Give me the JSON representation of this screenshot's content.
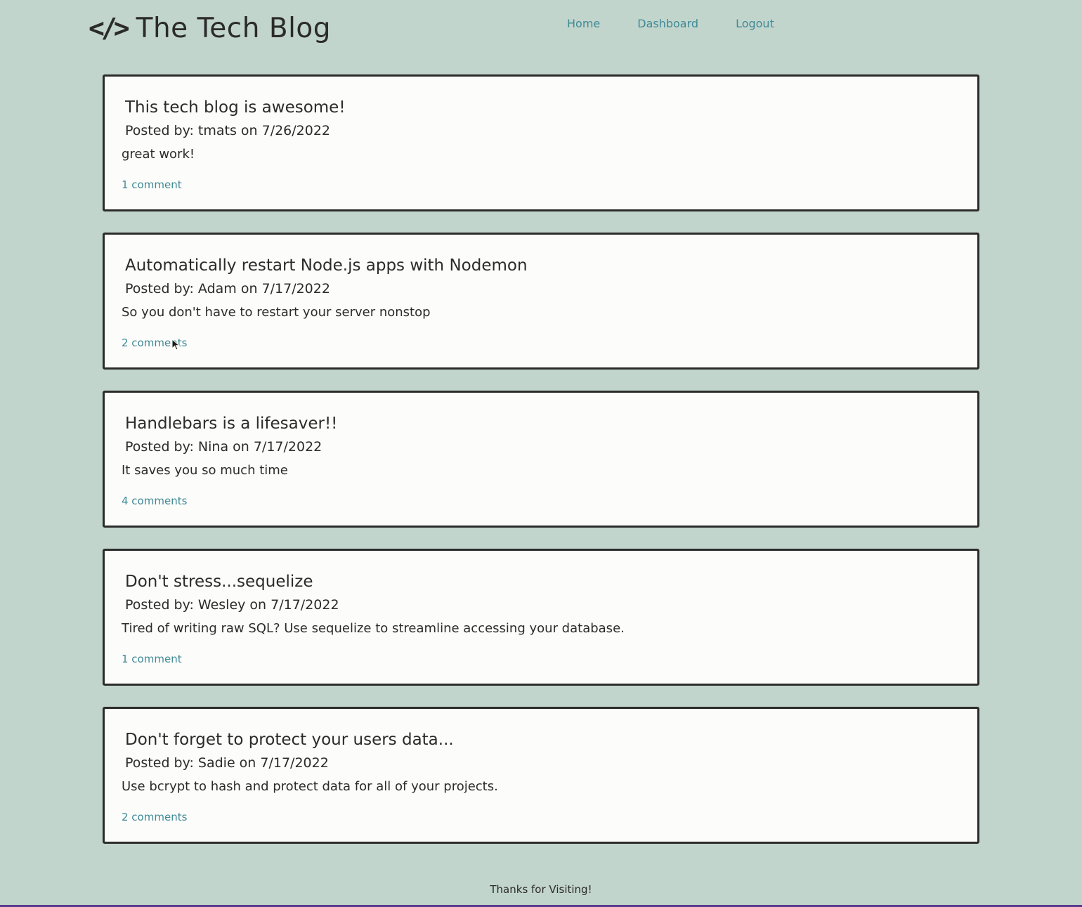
{
  "header": {
    "logo_icon": "</>",
    "title": "The Tech Blog",
    "nav": [
      "Home",
      "Dashboard",
      "Logout"
    ]
  },
  "posts": [
    {
      "title": "This tech blog is awesome!",
      "meta": "Posted by: tmats on 7/26/2022",
      "body": "great work!",
      "comments": "1 comment"
    },
    {
      "title": "Automatically restart Node.js apps with Nodemon",
      "meta": "Posted by: Adam on 7/17/2022",
      "body": "So you don't have to restart your server nonstop",
      "comments": "2 comments"
    },
    {
      "title": "Handlebars is a lifesaver!!",
      "meta": "Posted by: Nina on 7/17/2022",
      "body": "It saves you so much time",
      "comments": "4 comments"
    },
    {
      "title": "Don't stress...sequelize",
      "meta": "Posted by: Wesley on 7/17/2022",
      "body": "Tired of writing raw SQL? Use sequelize to streamline accessing your database.",
      "comments": "1 comment"
    },
    {
      "title": "Don't forget to protect your users data...",
      "meta": "Posted by: Sadie on 7/17/2022",
      "body": "Use bcrypt to hash and protect data for all of your projects.",
      "comments": "2 comments"
    }
  ],
  "footer": {
    "text": "Thanks for Visiting!"
  },
  "colors": {
    "background": "#c2d5cc",
    "link": "#3f8a96",
    "card": "#fcfcfa",
    "text": "#2b2b2b"
  }
}
